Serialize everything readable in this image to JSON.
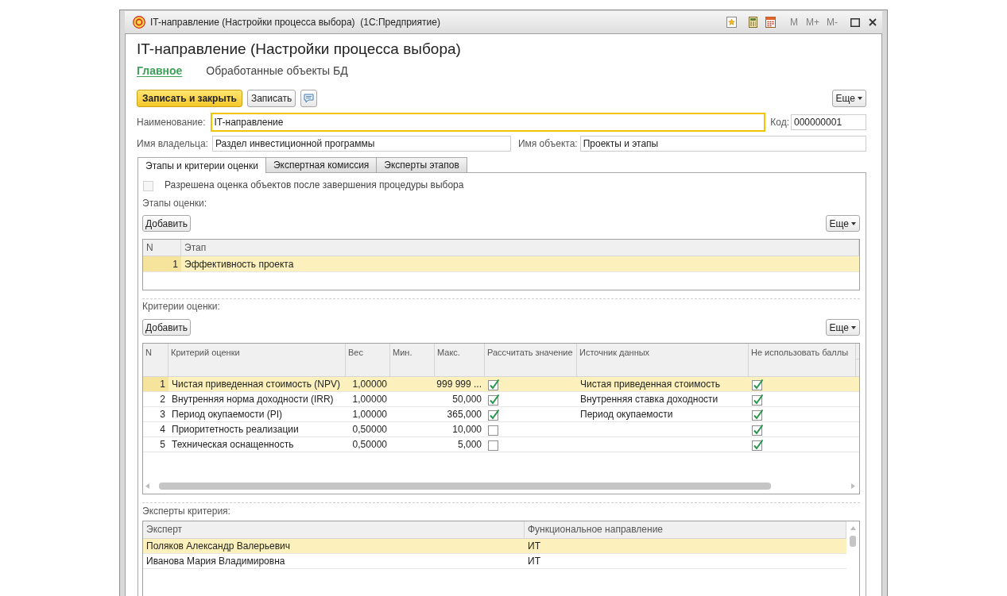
{
  "window": {
    "title": "IT-направление (Настройки процесса выбора)  (1С:Предприятие)",
    "memory_buttons": [
      {
        "label": "M",
        "disabled": true
      },
      {
        "label": "M+",
        "disabled": true
      },
      {
        "label": "M-",
        "disabled": true
      }
    ]
  },
  "header": {
    "title": "IT-направление (Настройки процесса выбора)",
    "nav": [
      {
        "label": "Главное",
        "selected": true
      },
      {
        "label": "Обработанные объекты БД",
        "selected": false
      }
    ]
  },
  "command_bar": {
    "buttons": [
      {
        "kind": "primary",
        "label": "Записать и закрыть"
      },
      {
        "kind": "normal",
        "label": "Записать"
      },
      {
        "kind": "comment"
      }
    ],
    "more": "Еще"
  },
  "fields": {
    "name": {
      "label": "Наименование:",
      "value": "IT-направление",
      "focused": true
    },
    "code": {
      "label": "Код:",
      "value": "000000001",
      "focused": false
    },
    "owner_name": {
      "label": "Имя владельца:",
      "value": "Раздел инвестиционной программы",
      "focused": false
    },
    "object_name": {
      "label": "Имя объекта:",
      "value": "Проекты и этапы",
      "focused": false
    }
  },
  "tabs": [
    {
      "label": "Этапы и критерии оценки",
      "selected": true
    },
    {
      "label": "Экспертная комиссия",
      "selected": false
    },
    {
      "label": "Эксперты этапов",
      "selected": false
    }
  ],
  "allow_evaluation": {
    "label": "Разрешена оценка объектов после завершения процедуры выбора",
    "checked": false,
    "disabled": true
  },
  "stages": {
    "label": "Этапы оценки:",
    "add_button": "Добавить",
    "more_button": "Еще",
    "columns": [
      "N",
      "Этап"
    ],
    "rows": [
      {
        "n": "1",
        "name": "Эффективность проекта",
        "selected": true
      }
    ]
  },
  "criteria": {
    "label": "Критерии оценки:",
    "add_button": "Добавить",
    "more_button": "Еще",
    "columns": [
      "N",
      "Критерий оценки",
      "Вес",
      "Мин.",
      "Макс.",
      "Рассчитать значение",
      "Источник данных",
      "Не использовать баллы"
    ],
    "rows": [
      {
        "n": "1",
        "criterion": "Чистая приведенная стоимость (NPV)",
        "weight": "1,00000",
        "max": "999 999 ...",
        "calculate": true,
        "source": "Чистая приведенная стоимость",
        "no_points": true,
        "selected": true
      },
      {
        "n": "2",
        "criterion": "Внутренняя норма доходности (IRR)",
        "weight": "1,00000",
        "max": "50,000",
        "calculate": true,
        "source": "Внутренняя ставка доходности",
        "no_points": true,
        "selected": false
      },
      {
        "n": "3",
        "criterion": "Период окупаемости (PI)",
        "weight": "1,00000",
        "max": "365,000",
        "calculate": true,
        "source": "Период окупаемости",
        "no_points": true,
        "selected": false
      },
      {
        "n": "4",
        "criterion": "Приоритетность реализации",
        "weight": "0,50000",
        "max": "10,000",
        "calculate": false,
        "no_points": true,
        "selected": false
      },
      {
        "n": "5",
        "criterion": "Техническая оснащенность",
        "weight": "0,50000",
        "max": "5,000",
        "calculate": false,
        "no_points": true,
        "selected": false
      }
    ]
  },
  "criterion_experts": {
    "label": "Эксперты критерия:",
    "columns": [
      "Эксперт",
      "Функциональное направление"
    ],
    "rows": [
      {
        "name": "Поляков Александр Валерьевич",
        "direction": "ИТ",
        "selected": true
      },
      {
        "name": "Иванова Мария Владимировна",
        "direction": "ИТ",
        "selected": false
      }
    ]
  }
}
